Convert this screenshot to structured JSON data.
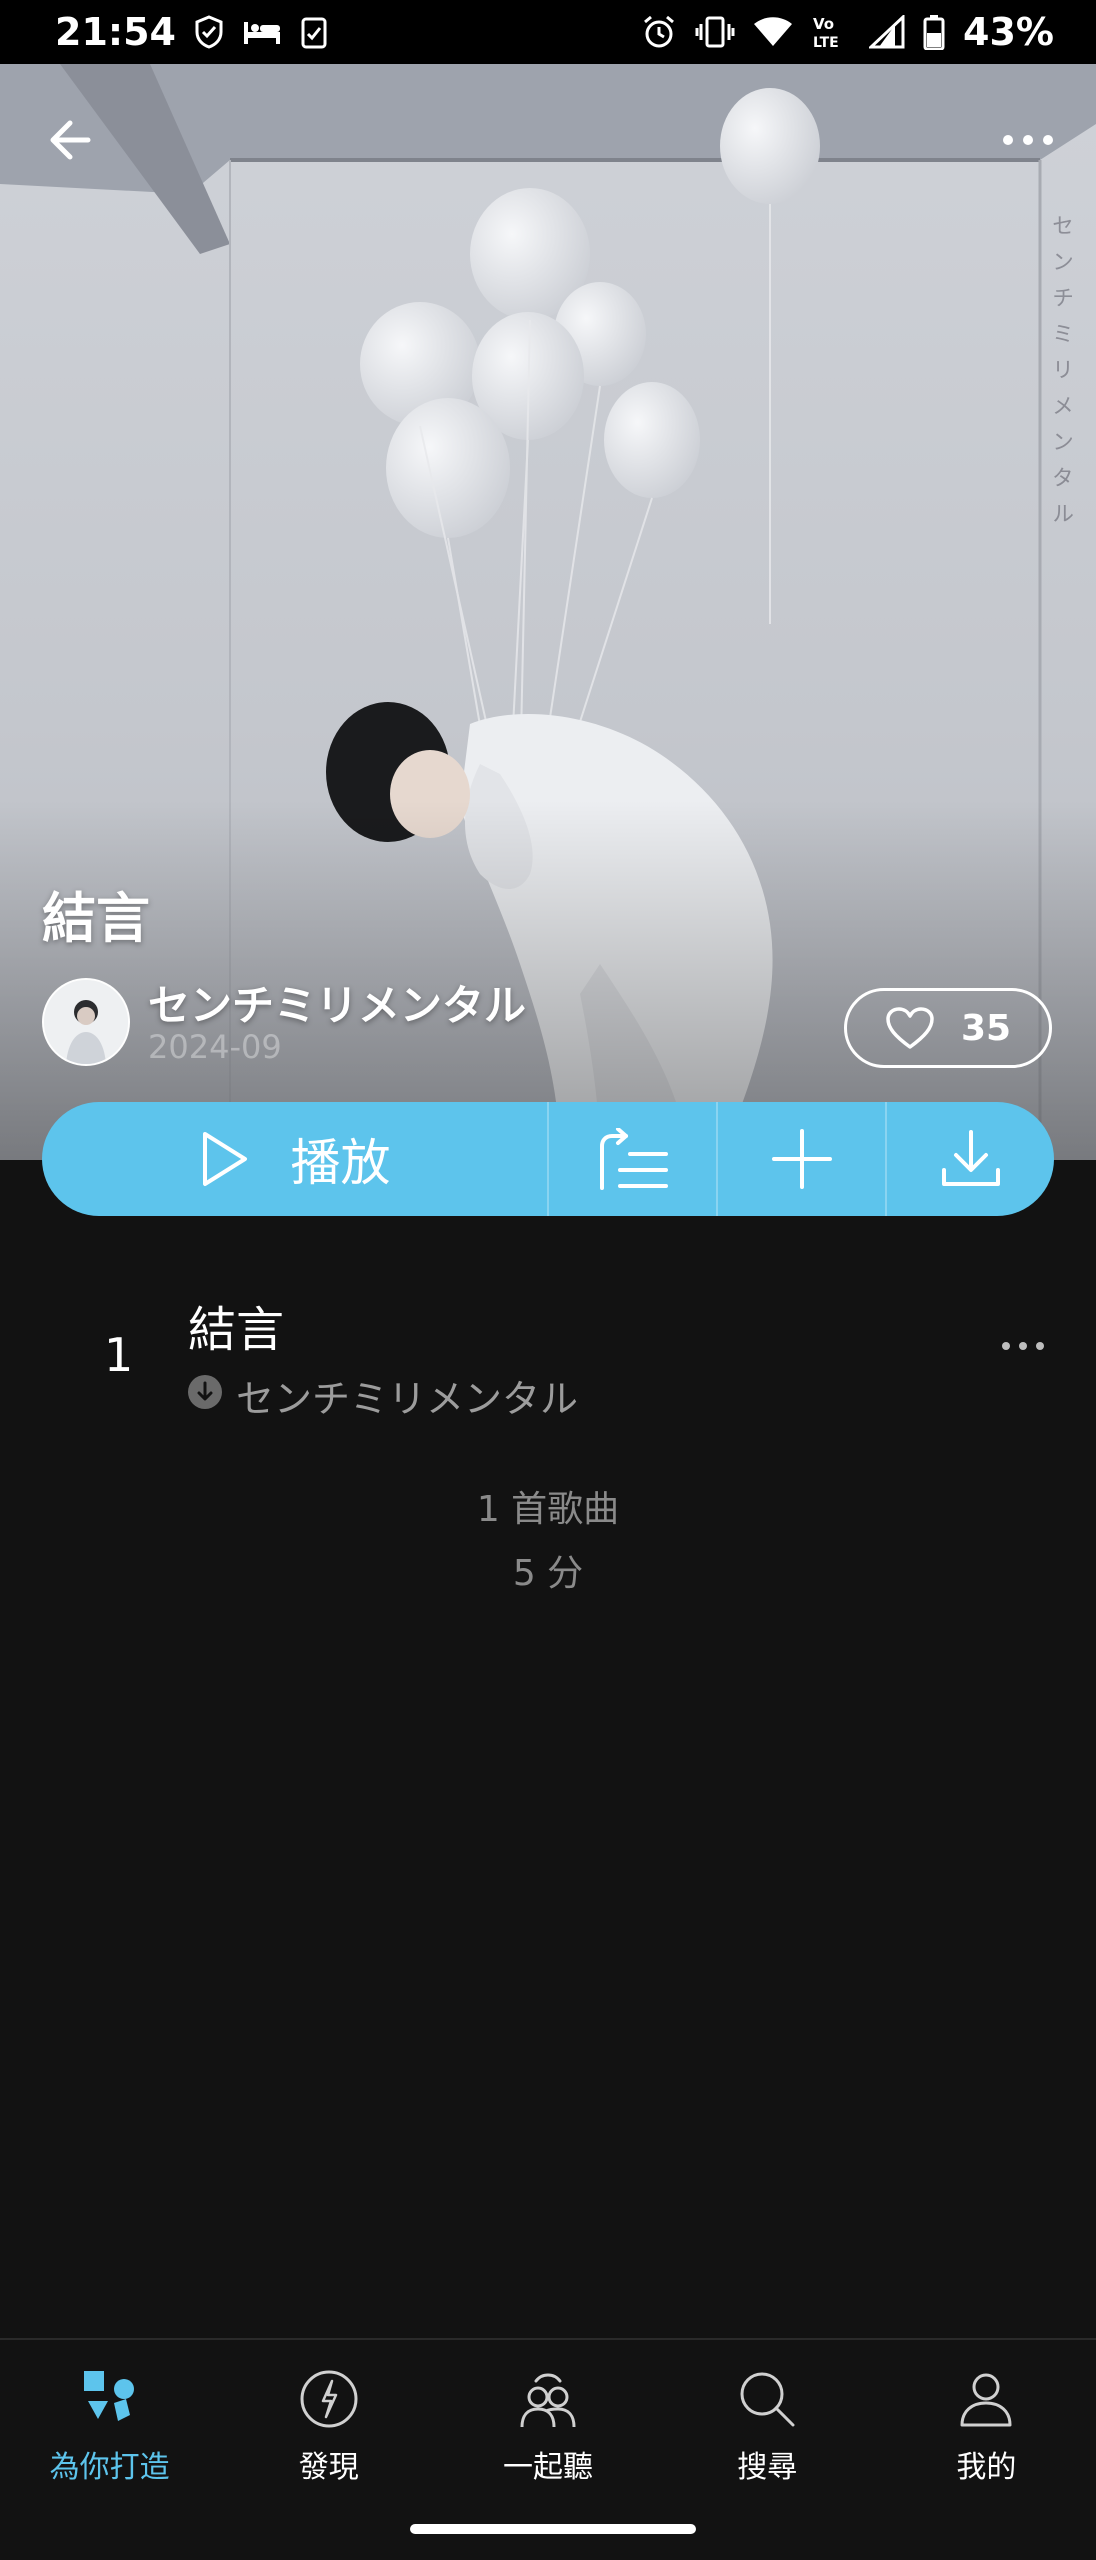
{
  "status_bar": {
    "time": "21:54",
    "battery": "43%"
  },
  "hero": {
    "vertical_text": "センチミリメンタル",
    "album_title": "結言",
    "artist_name": "センチミリメンタル",
    "release_date": "2024-09",
    "like_count": "35"
  },
  "actions": {
    "play_label": "播放"
  },
  "tracks": [
    {
      "number": "1",
      "title": "結言",
      "artist": "センチミリメンタル"
    }
  ],
  "summary": {
    "song_count": "1 首歌曲",
    "duration": "5 分"
  },
  "bottom_nav": {
    "items": [
      {
        "label": "為你打造",
        "icon": "for-you-icon",
        "active": true
      },
      {
        "label": "發現",
        "icon": "compass-icon",
        "active": false
      },
      {
        "label": "一起聽",
        "icon": "listen-together-icon",
        "active": false
      },
      {
        "label": "搜尋",
        "icon": "search-icon",
        "active": false
      },
      {
        "label": "我的",
        "icon": "profile-icon",
        "active": false
      }
    ]
  },
  "colors": {
    "accent": "#5dc4ec",
    "background": "#121212",
    "muted_text": "#8a8a8a"
  }
}
